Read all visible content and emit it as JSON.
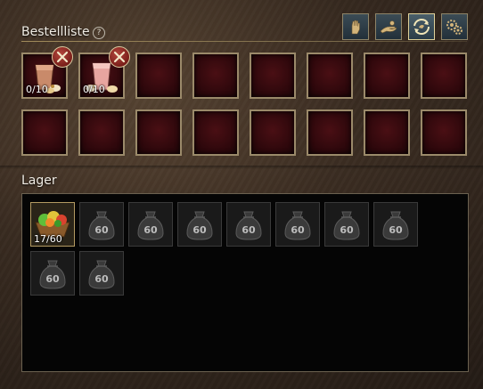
{
  "order_list": {
    "title": "Bestellliste",
    "help_symbol": "?",
    "slots_row1": [
      {
        "item": "drink-cup-brown",
        "count": "0/10",
        "removable": true
      },
      {
        "item": "drink-cup-pink",
        "count": "0/10",
        "removable": true
      },
      {
        "item": "",
        "count": ""
      },
      {
        "item": "",
        "count": ""
      },
      {
        "item": "",
        "count": ""
      },
      {
        "item": "",
        "count": ""
      },
      {
        "item": "",
        "count": ""
      },
      {
        "item": "",
        "count": ""
      }
    ],
    "slots_row2_count": 8
  },
  "toolbar": {
    "buttons": [
      {
        "icon": "hand-icon",
        "active": false
      },
      {
        "icon": "give-hand-icon",
        "active": false
      },
      {
        "icon": "cycle-arrows-icon",
        "active": true
      },
      {
        "icon": "gears-icon",
        "active": false
      }
    ]
  },
  "storage": {
    "title": "Lager",
    "items": [
      {
        "icon": "fruit-basket-icon",
        "count": "17/60"
      },
      {
        "icon": "bag-icon",
        "capacity": "60"
      },
      {
        "icon": "bag-icon",
        "capacity": "60"
      },
      {
        "icon": "bag-icon",
        "capacity": "60"
      },
      {
        "icon": "bag-icon",
        "capacity": "60"
      },
      {
        "icon": "bag-icon",
        "capacity": "60"
      },
      {
        "icon": "bag-icon",
        "capacity": "60"
      },
      {
        "icon": "bag-icon",
        "capacity": "60"
      },
      {
        "icon": "bag-icon",
        "capacity": "60"
      },
      {
        "icon": "bag-icon",
        "capacity": "60"
      }
    ]
  },
  "colors": {
    "slot_border": "#9b8a6a",
    "slot_fill": "#2c070b",
    "remove_badge": "#7a1f1a",
    "active_button_border": "#e0d29a"
  }
}
